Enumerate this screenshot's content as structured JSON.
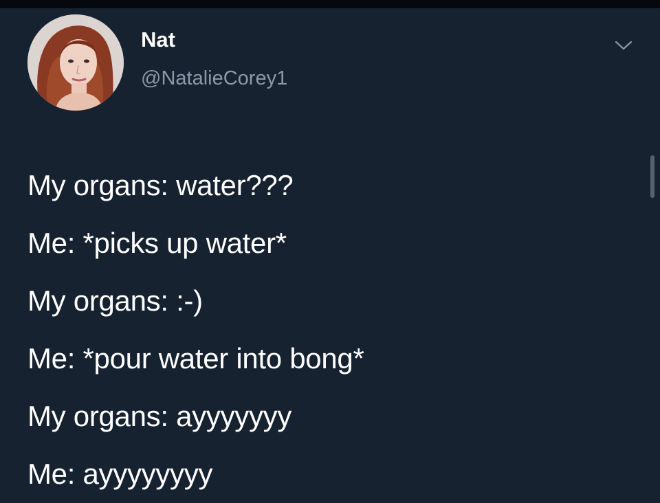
{
  "tweet": {
    "author": {
      "display_name": "Nat",
      "handle": "@NatalieCorey1",
      "avatar_icon": "profile-photo"
    },
    "menu_icon": "chevron-down-icon",
    "lines": [
      "My organs: water???",
      "Me: *picks up water*",
      "My organs: :-)",
      "Me: *pour water into bong*",
      "My organs: ayyyyyyy",
      "Me: ayyyyyyyy"
    ]
  },
  "colors": {
    "background": "#172231",
    "text": "#ffffff",
    "secondary_text": "#8b98a6",
    "chevron": "#8b98a6"
  }
}
